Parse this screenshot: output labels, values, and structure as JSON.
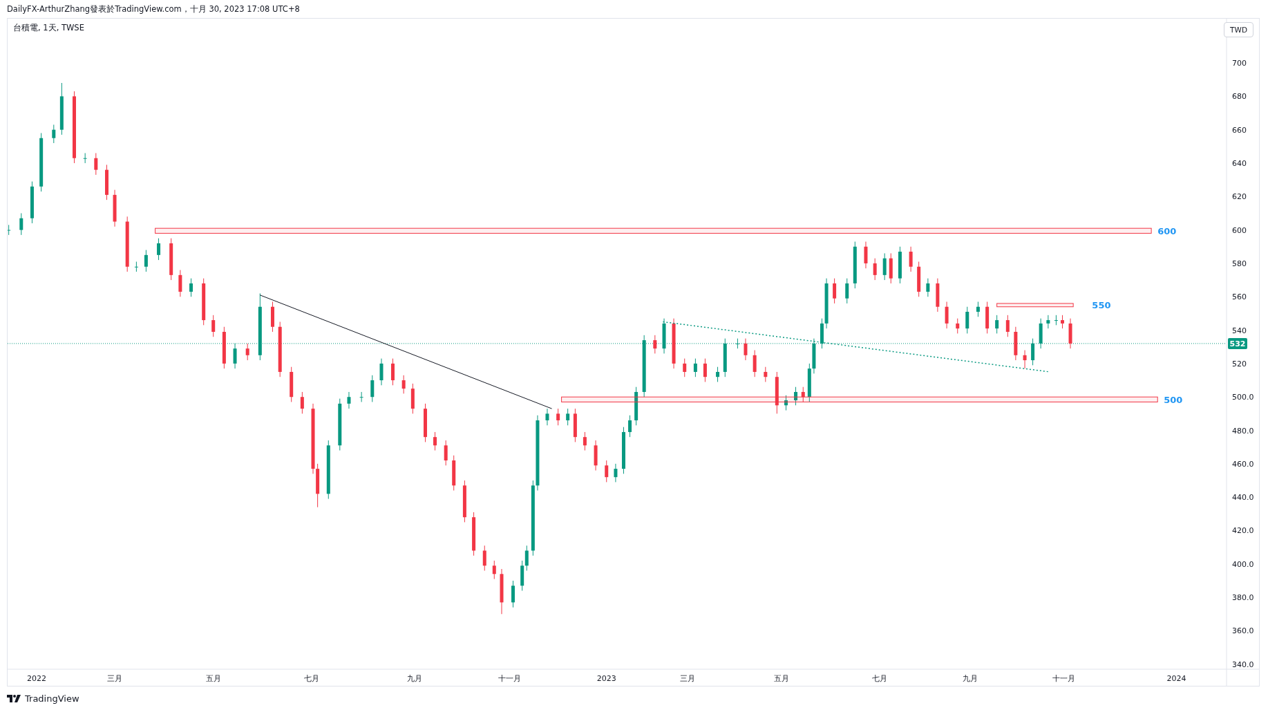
{
  "header": {
    "text": "DailyFX-ArthurZhang發表於TradingView.com，十月 30, 2023 17:08 UTC+8"
  },
  "legend": "台積電, 1天, TWSE",
  "currency_button": "TWD",
  "chart": {
    "chart_data": {
      "type": "candlestick",
      "xlim": [
        2021.949,
        2024.145
      ],
      "ylim": [
        337,
        726.5
      ],
      "x": [
        2021.951,
        2021.973,
        2021.992,
        2022.008,
        2022.03,
        2022.044,
        2022.066,
        2022.085,
        2022.104,
        2022.123,
        2022.137,
        2022.159,
        2022.175,
        2022.192,
        2022.214,
        2022.236,
        2022.252,
        2022.271,
        2022.293,
        2022.31,
        2022.329,
        2022.348,
        2022.37,
        2022.392,
        2022.414,
        2022.427,
        2022.447,
        2022.466,
        2022.485,
        2022.493,
        2022.512,
        2022.532,
        2022.548,
        2022.57,
        2022.589,
        2022.605,
        2022.625,
        2022.644,
        2022.66,
        2022.682,
        2022.699,
        2022.718,
        2022.732,
        2022.751,
        2022.767,
        2022.786,
        2022.803,
        2022.816,
        2022.836,
        2022.852,
        2022.86,
        2022.871,
        2022.879,
        2022.896,
        2022.915,
        2022.932,
        2022.945,
        2022.962,
        2022.981,
        2023.0,
        2023.016,
        2023.03,
        2023.041,
        2023.052,
        2023.066,
        2023.085,
        2023.101,
        2023.118,
        2023.137,
        2023.156,
        2023.173,
        2023.195,
        2023.208,
        2023.23,
        2023.244,
        2023.26,
        2023.279,
        2023.299,
        2023.315,
        2023.332,
        2023.345,
        2023.356,
        2023.364,
        2023.378,
        2023.386,
        2023.4,
        2023.422,
        2023.436,
        2023.455,
        2023.471,
        2023.488,
        2023.499,
        2023.515,
        2023.534,
        2023.548,
        2023.564,
        2023.581,
        2023.597,
        2023.616,
        2023.633,
        2023.652,
        2023.668,
        2023.685,
        2023.704,
        2023.718,
        2023.734,
        2023.748,
        2023.762,
        2023.775,
        2023.789,
        2023.8,
        2023.814
      ],
      "ohlc": [
        [
          600,
          603,
          597,
          600
        ],
        [
          600,
          610,
          597,
          607
        ],
        [
          607,
          629,
          604,
          626
        ],
        [
          626,
          658,
          623,
          655
        ],
        [
          655,
          663,
          652,
          660
        ],
        [
          660,
          688,
          657,
          680
        ],
        [
          680,
          683,
          640,
          643
        ],
        [
          643,
          646,
          640,
          643
        ],
        [
          643,
          646,
          633,
          636
        ],
        [
          636,
          639,
          618,
          621
        ],
        [
          621,
          624,
          602,
          605
        ],
        [
          605,
          608,
          575,
          578
        ],
        [
          578,
          581,
          575,
          578
        ],
        [
          578,
          588,
          575,
          585
        ],
        [
          585,
          595,
          582,
          592
        ],
        [
          592,
          595,
          570,
          573
        ],
        [
          573,
          576,
          560,
          563
        ],
        [
          563,
          571,
          560,
          568
        ],
        [
          568,
          571,
          543,
          546
        ],
        [
          546,
          549,
          536,
          539
        ],
        [
          539,
          542,
          517,
          520
        ],
        [
          520,
          532,
          517,
          529
        ],
        [
          529,
          532,
          522,
          525
        ],
        [
          525,
          562,
          522,
          554
        ],
        [
          554,
          557,
          539,
          542
        ],
        [
          542,
          545,
          512,
          515
        ],
        [
          515,
          518,
          497,
          500
        ],
        [
          500,
          503,
          490,
          493
        ],
        [
          493,
          496,
          454,
          457
        ],
        [
          457,
          460,
          434,
          442
        ],
        [
          442,
          474,
          439,
          471
        ],
        [
          471,
          499,
          468,
          496
        ],
        [
          496,
          503,
          493,
          500
        ],
        [
          500,
          503,
          497,
          500
        ],
        [
          500,
          513,
          497,
          510
        ],
        [
          510,
          523,
          507,
          520
        ],
        [
          520,
          523,
          507,
          510
        ],
        [
          510,
          513,
          502,
          505
        ],
        [
          505,
          508,
          490,
          493
        ],
        [
          493,
          496,
          473,
          476
        ],
        [
          476,
          479,
          468,
          471
        ],
        [
          471,
          474,
          459,
          462
        ],
        [
          462,
          465,
          444,
          447
        ],
        [
          447,
          450,
          425,
          428
        ],
        [
          428,
          431,
          405,
          408
        ],
        [
          408,
          411,
          396,
          399
        ],
        [
          399,
          402,
          391,
          394
        ],
        [
          394,
          397,
          370,
          377
        ],
        [
          377,
          390,
          374,
          387
        ],
        [
          387,
          402,
          384,
          399
        ],
        [
          399,
          411,
          396,
          408
        ],
        [
          408,
          450,
          405,
          447
        ],
        [
          447,
          489,
          444,
          486
        ],
        [
          486,
          493,
          483,
          490
        ],
        [
          490,
          493,
          483,
          486
        ],
        [
          486,
          493,
          483,
          490
        ],
        [
          490,
          493,
          473,
          476
        ],
        [
          476,
          479,
          468,
          471
        ],
        [
          471,
          474,
          456,
          459
        ],
        [
          459,
          462,
          449,
          452
        ],
        [
          452,
          460,
          449,
          457
        ],
        [
          457,
          482,
          454,
          479
        ],
        [
          479,
          489,
          476,
          486
        ],
        [
          486,
          506,
          483,
          503
        ],
        [
          503,
          537,
          500,
          534
        ],
        [
          534,
          537,
          526,
          529
        ],
        [
          529,
          547,
          526,
          544
        ],
        [
          544,
          547,
          517,
          520
        ],
        [
          520,
          523,
          512,
          515
        ],
        [
          515,
          523,
          512,
          520
        ],
        [
          520,
          523,
          509,
          512
        ],
        [
          512,
          518,
          509,
          515
        ],
        [
          515,
          535,
          512,
          532
        ],
        [
          532,
          535,
          529,
          532
        ],
        [
          532,
          535,
          522,
          525
        ],
        [
          525,
          528,
          512,
          515
        ],
        [
          515,
          518,
          509,
          512
        ],
        [
          512,
          515,
          490,
          495
        ],
        [
          495,
          501,
          492,
          498
        ],
        [
          498,
          506,
          495,
          503
        ],
        [
          503,
          506,
          497,
          500
        ],
        [
          500,
          520,
          497,
          517
        ],
        [
          517,
          535,
          514,
          532
        ],
        [
          532,
          547,
          529,
          544
        ],
        [
          544,
          571,
          541,
          568
        ],
        [
          568,
          571,
          556,
          559
        ],
        [
          559,
          571,
          556,
          568
        ],
        [
          568,
          593,
          565,
          590
        ],
        [
          590,
          593,
          577,
          580
        ],
        [
          580,
          583,
          570,
          573
        ],
        [
          573,
          586,
          570,
          583
        ],
        [
          583,
          586,
          568,
          571
        ],
        [
          571,
          590,
          568,
          587
        ],
        [
          587,
          590,
          575,
          578
        ],
        [
          578,
          581,
          560,
          563
        ],
        [
          563,
          571,
          560,
          568
        ],
        [
          568,
          571,
          551,
          554
        ],
        [
          554,
          557,
          541,
          544
        ],
        [
          544,
          547,
          538,
          541
        ],
        [
          541,
          554,
          538,
          551
        ],
        [
          551,
          557,
          548,
          554
        ],
        [
          554,
          557,
          538,
          541
        ],
        [
          541,
          549,
          538,
          546
        ],
        [
          546,
          549,
          536,
          539
        ],
        [
          539,
          542,
          522,
          525
        ],
        [
          525,
          528,
          517,
          522
        ],
        [
          522,
          535,
          519,
          532
        ],
        [
          532,
          547,
          529,
          544
        ],
        [
          544,
          549,
          541,
          546
        ],
        [
          546,
          549,
          543,
          546
        ],
        [
          546,
          549,
          541,
          544
        ],
        [
          544,
          547,
          529,
          532
        ]
      ],
      "yticks": [
        700,
        680,
        660,
        640,
        620,
        600,
        580,
        560,
        540,
        520,
        {
          "value": 500,
          "label": "500.0"
        },
        {
          "value": 480,
          "label": "480.0"
        },
        {
          "value": 460,
          "label": "460.0"
        },
        {
          "value": 440,
          "label": "440.0"
        },
        {
          "value": 420,
          "label": "420.0"
        },
        {
          "value": 400,
          "label": "400.0"
        },
        {
          "value": 380,
          "label": "380.0"
        },
        {
          "value": 360,
          "label": "360.0"
        },
        {
          "value": 340,
          "label": "340.0"
        }
      ],
      "xticks": [
        {
          "value": 2022,
          "label": "2022"
        },
        {
          "value": 2022.137,
          "label": "三月"
        },
        {
          "value": 2022.31,
          "label": "五月"
        },
        {
          "value": 2022.482,
          "label": "七月"
        },
        {
          "value": 2022.663,
          "label": "九月"
        },
        {
          "value": 2022.83,
          "label": "十一月"
        },
        {
          "value": 2023,
          "label": "2023"
        },
        {
          "value": 2023.142,
          "label": "三月"
        },
        {
          "value": 2023.307,
          "label": "五月"
        },
        {
          "value": 2023.479,
          "label": "七月"
        },
        {
          "value": 2023.638,
          "label": "九月"
        },
        {
          "value": 2023.803,
          "label": "十一月"
        },
        {
          "value": 2024,
          "label": "2024"
        }
      ],
      "bands": [
        {
          "axis": "y",
          "from": 598,
          "to": 601
        },
        {
          "axis": "y",
          "from": 554,
          "to": 556
        },
        {
          "axis": "y",
          "from": 497,
          "to": 500
        }
      ],
      "annotations": [
        "600",
        "550",
        "500"
      ],
      "ref_lines": [
        {
          "axis": "y",
          "value": 532,
          "label": "532"
        }
      ]
    },
    "drawings": [
      {
        "kind": "trend_line"
      },
      {
        "kind": "dotted_line"
      }
    ]
  },
  "footer": {
    "brand": "TradingView"
  }
}
